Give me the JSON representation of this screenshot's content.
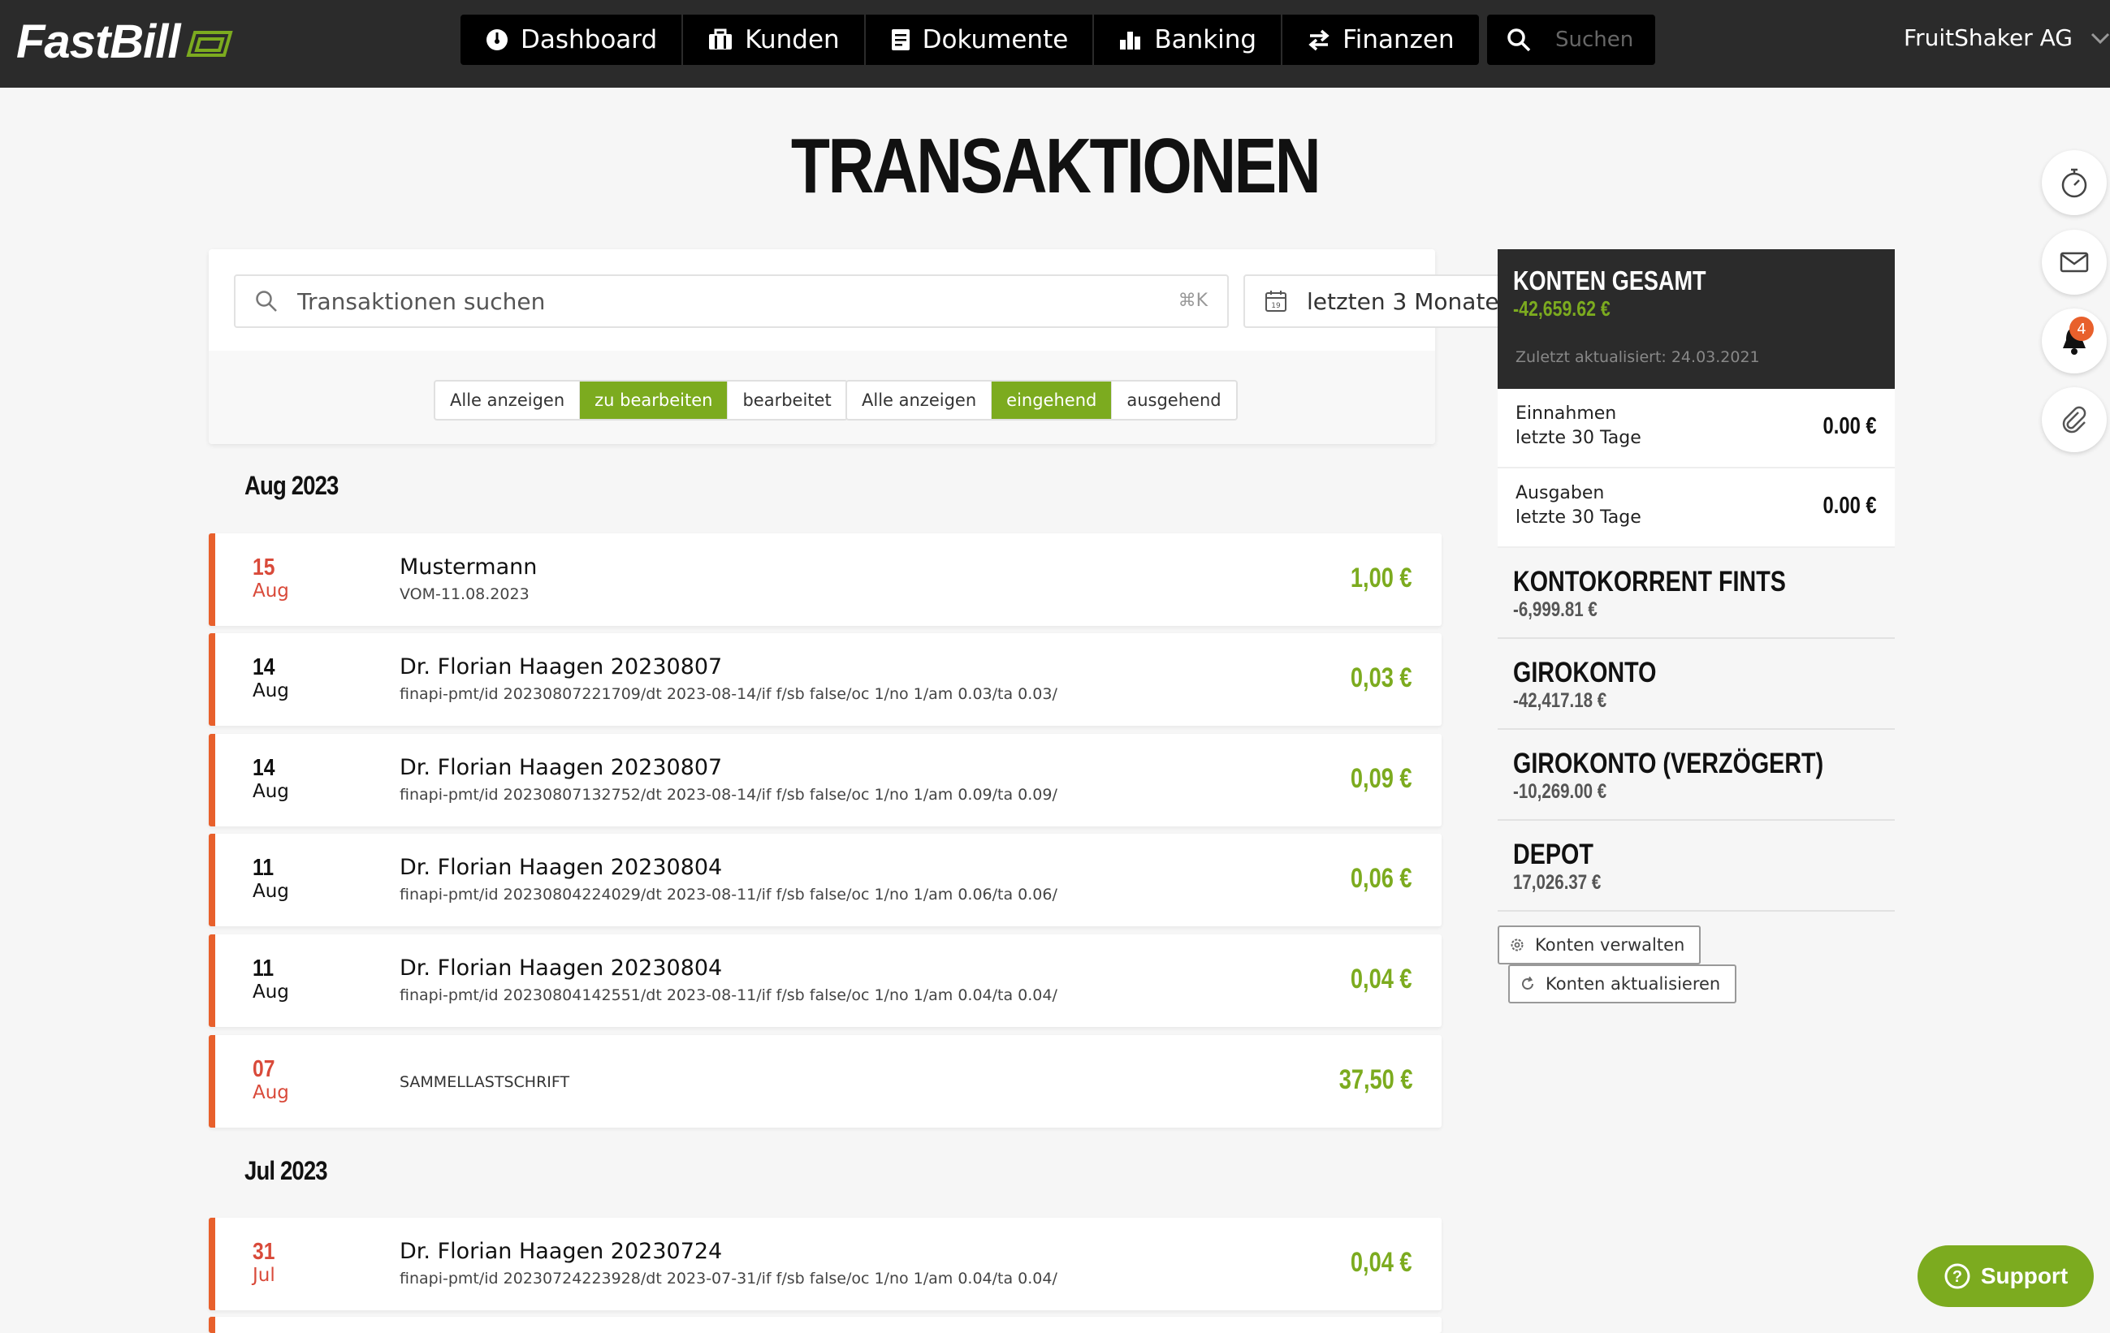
{
  "app": {
    "name": "FastBill"
  },
  "nav": [
    {
      "label": "Dashboard",
      "icon": "dashboard-icon"
    },
    {
      "label": "Kunden",
      "icon": "briefcase-icon"
    },
    {
      "label": "Dokumente",
      "icon": "document-icon"
    },
    {
      "label": "Banking",
      "icon": "bar-chart-icon"
    },
    {
      "label": "Finanzen",
      "icon": "transfer-icon"
    }
  ],
  "search": {
    "placeholder": "Suchen"
  },
  "company": {
    "name": "FruitShaker AG"
  },
  "page": {
    "title": "TRANSAKTIONEN"
  },
  "filter": {
    "search_placeholder": "Transaktionen suchen",
    "shortcut": "⌘K",
    "period": "letzten 3 Monate",
    "status": {
      "all": "Alle anzeigen",
      "todo": "zu bearbeiten",
      "done": "bearbeitet",
      "active": "zu bearbeiten"
    },
    "direction": {
      "all": "Alle anzeigen",
      "in": "eingehend",
      "out": "ausgehend",
      "active": "eingehend"
    }
  },
  "months": [
    {
      "label": "Aug 2023",
      "transactions": [
        {
          "day": "15",
          "month": "Aug",
          "title": "Mustermann",
          "subtitle": "VOM-11.08.2023",
          "amount": "1,00 €",
          "date_color": "red"
        },
        {
          "day": "14",
          "month": "Aug",
          "title": "Dr. Florian Haagen 20230807",
          "subtitle": "finapi-pmt/id 20230807221709/dt 2023-08-14/if f/sb false/oc 1/no 1/am 0.03/ta 0.03/",
          "amount": "0,03 €",
          "date_color": "black"
        },
        {
          "day": "14",
          "month": "Aug",
          "title": "Dr. Florian Haagen 20230807",
          "subtitle": "finapi-pmt/id 20230807132752/dt 2023-08-14/if f/sb false/oc 1/no 1/am 0.09/ta 0.09/",
          "amount": "0,09 €",
          "date_color": "black"
        },
        {
          "day": "11",
          "month": "Aug",
          "title": "Dr. Florian Haagen 20230804",
          "subtitle": "finapi-pmt/id 20230804224029/dt 2023-08-11/if f/sb false/oc 1/no 1/am 0.06/ta 0.06/",
          "amount": "0,06 €",
          "date_color": "black"
        },
        {
          "day": "11",
          "month": "Aug",
          "title": "Dr. Florian Haagen 20230804",
          "subtitle": "finapi-pmt/id 20230804142551/dt 2023-08-11/if f/sb false/oc 1/no 1/am 0.04/ta 0.04/",
          "amount": "0,04 €",
          "date_color": "black"
        },
        {
          "day": "07",
          "month": "Aug",
          "title": "",
          "subtitle": "SAMMELLASTSCHRIFT",
          "amount": "37,50 €",
          "date_color": "red"
        }
      ]
    },
    {
      "label": "Jul 2023",
      "transactions": [
        {
          "day": "31",
          "month": "Jul",
          "title": "Dr. Florian Haagen 20230724",
          "subtitle": "finapi-pmt/id 20230724223928/dt 2023-07-31/if f/sb false/oc 1/no 1/am 0.04/ta 0.04/",
          "amount": "0,04 €",
          "date_color": "red"
        }
      ]
    }
  ],
  "accounts_panel": {
    "total_title": "KONTEN GESAMT",
    "total_amount": "-42,659.62 €",
    "updated": "Zuletzt aktualisiert: 24.03.2021",
    "income": {
      "line1": "Einnahmen",
      "line2": "letzte 30 Tage",
      "value": "0.00 €"
    },
    "expenses": {
      "line1": "Ausgaben",
      "line2": "letzte 30 Tage",
      "value": "0.00 €"
    },
    "accounts": [
      {
        "name": "KONTOKORRENT FINTS",
        "balance": "-6,999.81 €"
      },
      {
        "name": "GIROKONTO",
        "balance": "-42,417.18 €"
      },
      {
        "name": "GIROKONTO (VERZÖGERT)",
        "balance": "-10,269.00 €"
      },
      {
        "name": "DEPOT",
        "balance": "17,026.37 €"
      }
    ],
    "manage_label": "Konten verwalten",
    "refresh_label": "Konten aktualisieren"
  },
  "side_actions": {
    "notifications_count": "4"
  },
  "support": {
    "label": "Support"
  },
  "colors": {
    "accent": "#7cab1f",
    "date_red": "#d94a3a",
    "row_border": "#e8602c",
    "topbar": "#2b2b2b"
  }
}
